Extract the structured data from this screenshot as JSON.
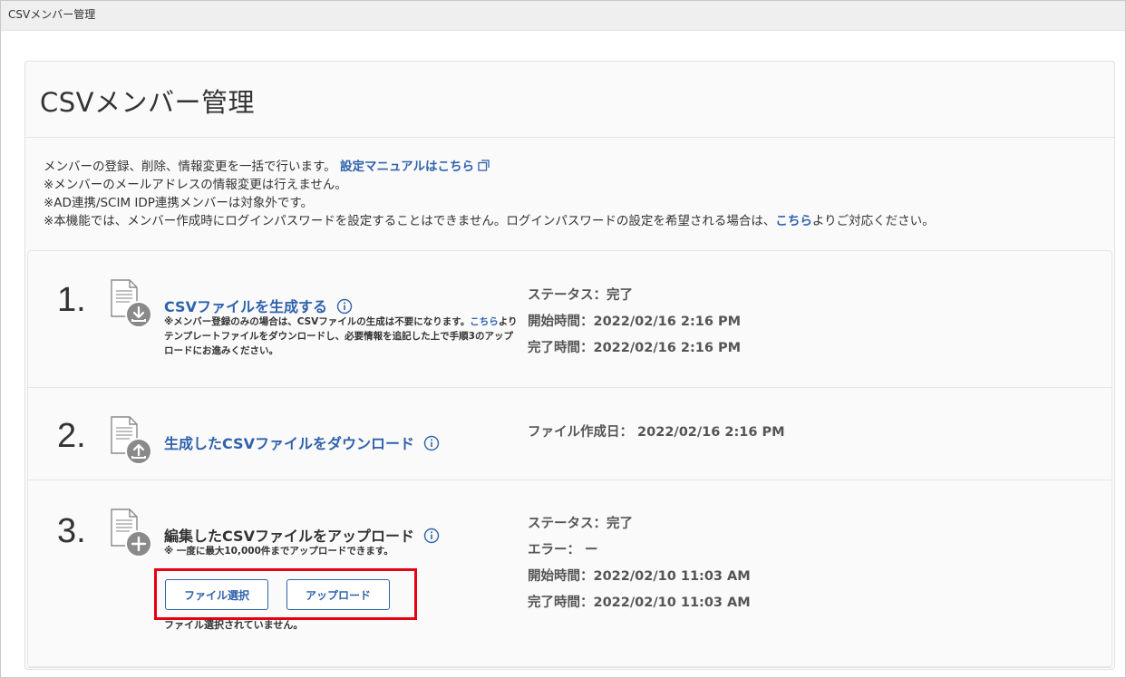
{
  "window": {
    "title": "CSVメンバー管理"
  },
  "header": {
    "title": "CSVメンバー管理"
  },
  "description": {
    "line1": "メンバーの登録、削除、情報変更を一括で行います。",
    "manual_link": "設定マニュアルはこちら",
    "line2": "※メンバーのメールアドレスの情報変更は行えません。",
    "line3": "※AD連携/SCIM IDP連携メンバーは対象外です。",
    "line4_before": "※本機能では、メンバー作成時にログインパスワードを設定することはできません。ログインパスワードの設定を希望される場合は、",
    "line4_link": "こちら",
    "line4_after": "よりご対応ください。"
  },
  "steps": [
    {
      "number": "1.",
      "title": "CSVファイルを生成する",
      "note_before": "※メンバー登録のみの場合は、CSVファイルの生成は不要になります。",
      "note_link": "こちら",
      "note_after": "よりテンプレートファイルをダウンロードし、必要情報を追記した上で手順3のアップロードにお進みください。",
      "status": "ステータス：完了",
      "start": "開始時間：2022/02/16 2:16 PM",
      "end": "完了時間：2022/02/16 2:16 PM"
    },
    {
      "number": "2.",
      "title": "生成したCSVファイルをダウンロード",
      "created": "ファイル作成日： 2022/02/16 2:16 PM"
    },
    {
      "number": "3.",
      "title": "編集したCSVファイルをアップロード",
      "note": "※ 一度に最大10,000件までアップロードできます。",
      "select_button": "ファイル選択",
      "upload_button": "アップロード",
      "file_status": "ファイル選択されていません。",
      "status": "ステータス：完了",
      "error": "エラー： ー",
      "start": "開始時間：2022/02/10 11:03 AM",
      "end": "完了時間：2022/02/10 11:03 AM"
    }
  ],
  "icons": {
    "download": "download-arrow-icon",
    "upload": "upload-arrow-icon",
    "add": "plus-icon",
    "info": "info-icon",
    "external": "external-link-icon"
  },
  "colors": {
    "link": "#2f62ad",
    "highlight": "#e60012",
    "icon_gray": "#8a8a8a"
  }
}
